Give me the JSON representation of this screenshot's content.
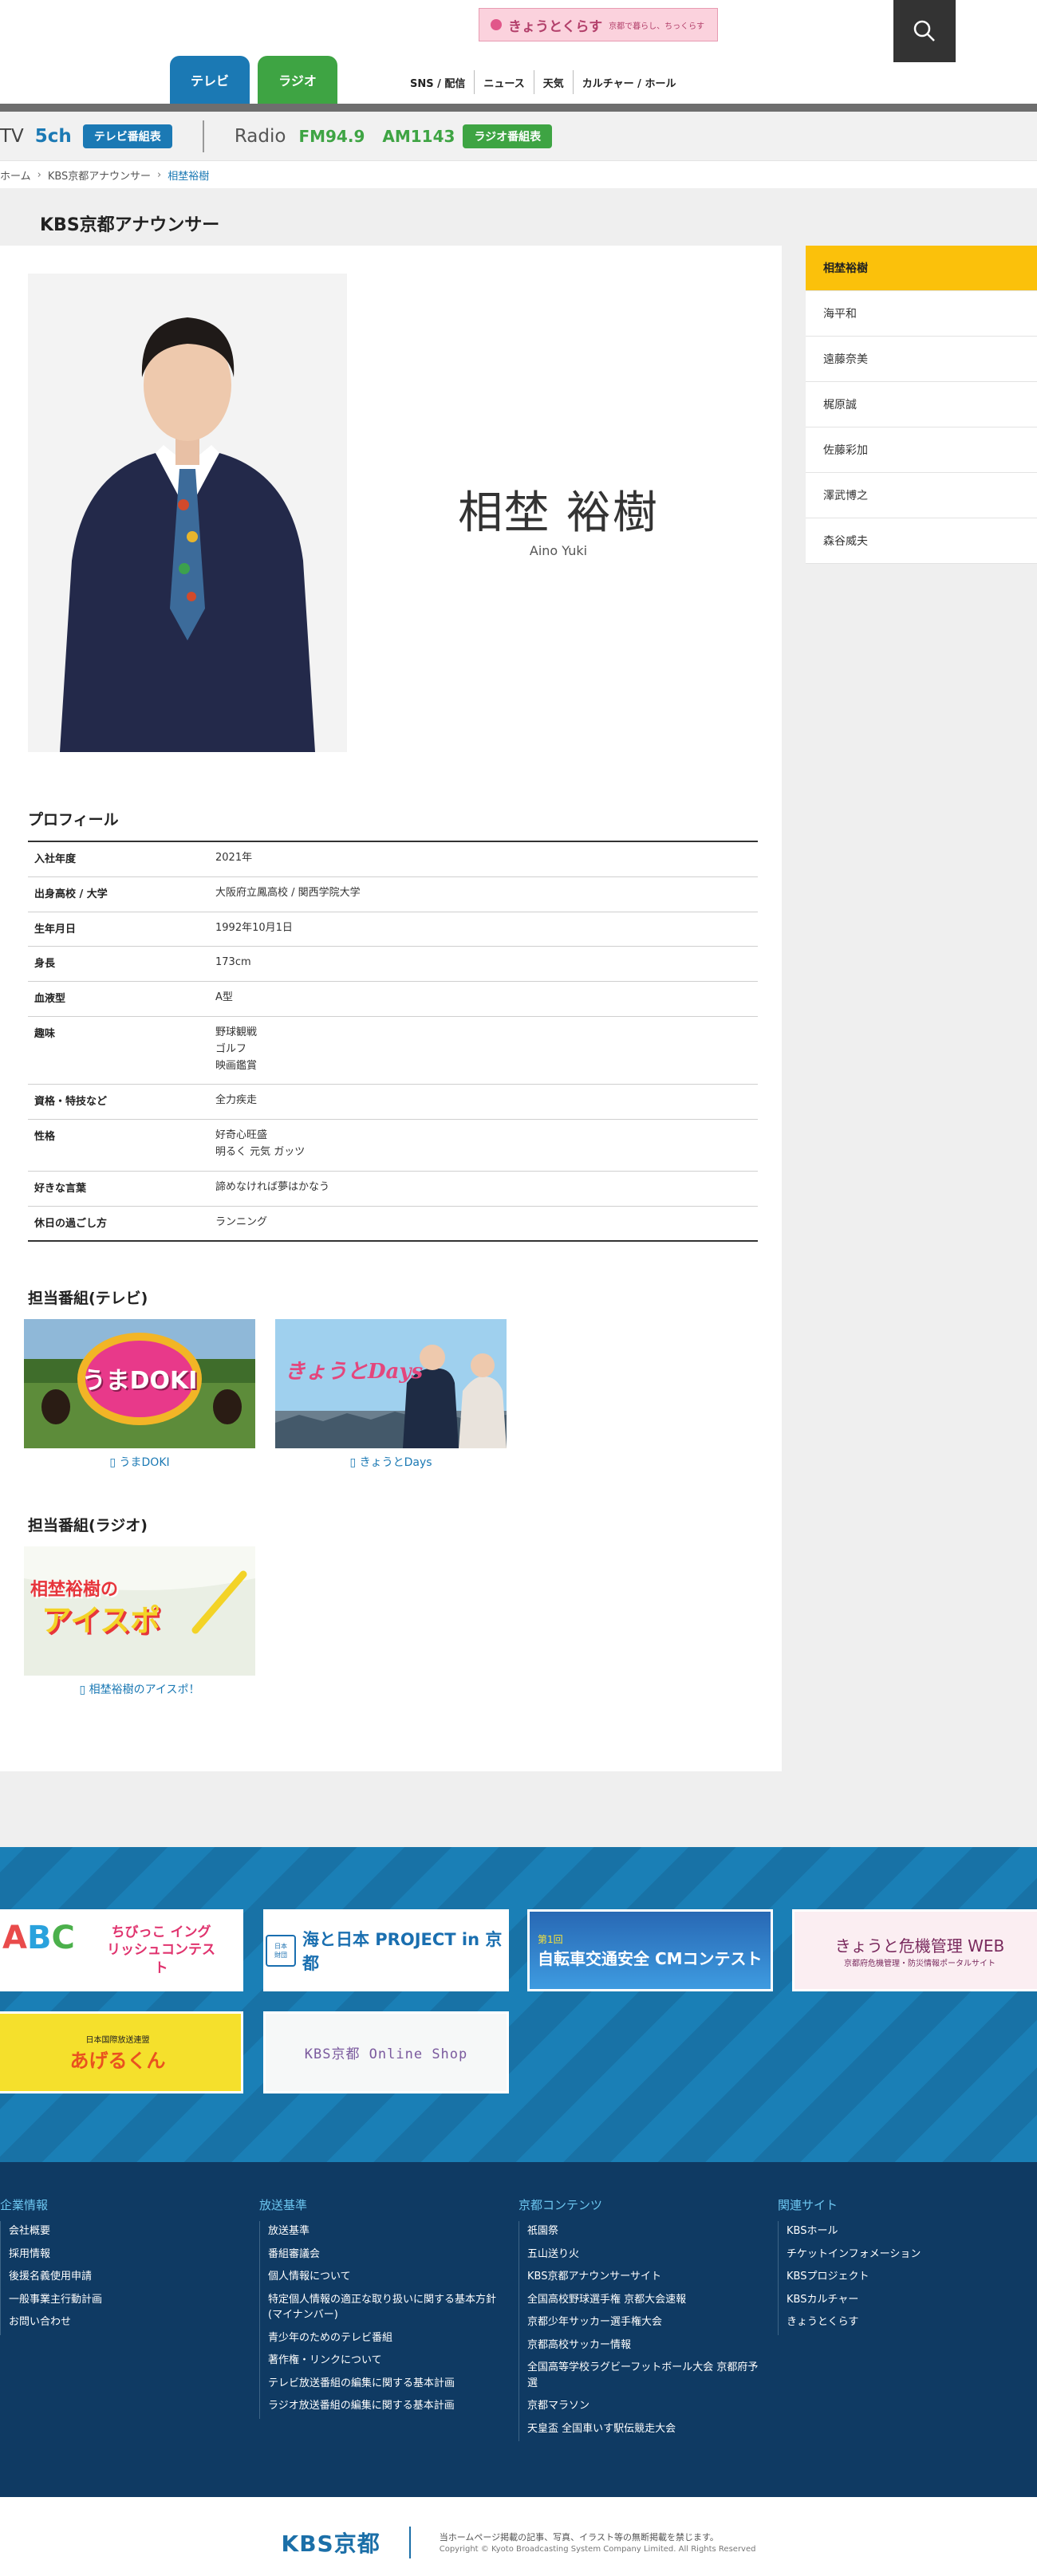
{
  "header": {
    "kyoto_banner_title": "きょうとくらす",
    "kyoto_banner_sub": "京都で暮らし、ちっくらす",
    "tabs": [
      {
        "label": "テレビ"
      },
      {
        "label": "ラジオ"
      }
    ],
    "gnav": [
      "SNS / 配信",
      "ニュース",
      "天気",
      "カルチャー / ホール"
    ]
  },
  "schedule": {
    "tv_label": "TV",
    "tv_channel": "5ch",
    "tv_button": "テレビ番組表",
    "radio_label": "Radio",
    "fm": "FM94.9",
    "am": "AM1143",
    "radio_button": "ラジオ番組表"
  },
  "breadcrumb": [
    "ホーム",
    "KBS京都アナウンサー",
    "相埜裕樹"
  ],
  "page_title": "KBS京都アナウンサー",
  "announcer": {
    "name_jp": "相埜 裕樹",
    "name_en": "Aino Yuki"
  },
  "profile": {
    "heading": "プロフィール",
    "rows": [
      {
        "k": "入社年度",
        "v": "2021年"
      },
      {
        "k": "出身高校 / 大学",
        "v": "大阪府立鳳高校 / 関西学院大学"
      },
      {
        "k": "生年月日",
        "v": "1992年10月1日"
      },
      {
        "k": "身長",
        "v": "173cm"
      },
      {
        "k": "血液型",
        "v": "A型"
      },
      {
        "k": "趣味",
        "v": "野球観戦\nゴルフ\n映画鑑賞"
      },
      {
        "k": "資格・特技など",
        "v": "全力疾走"
      },
      {
        "k": "性格",
        "v": "好奇心旺盛\n明るく 元気 ガッツ"
      },
      {
        "k": "好きな言葉",
        "v": "諦めなければ夢はかなう"
      },
      {
        "k": "休日の過ごし方",
        "v": "ランニング"
      }
    ]
  },
  "tv_programs": {
    "heading": "担当番組(テレビ)",
    "items": [
      {
        "caption": "うまDOKI",
        "logo": "うまDOKI"
      },
      {
        "caption": "きょうとDays",
        "logo": "きょうとDays"
      }
    ]
  },
  "radio_programs": {
    "heading": "担当番組(ラジオ)",
    "items": [
      {
        "caption": "相埜裕樹のアイスポ！",
        "logo_top": "相埜裕樹の",
        "logo_main": "アイスポ"
      }
    ]
  },
  "sidebar": [
    "相埜裕樹",
    "海平和",
    "遠藤奈美",
    "梶原誠",
    "佐藤彩加",
    "澤武博之",
    "森谷威夫"
  ],
  "banners": [
    {
      "text": "ちびっこ イングリッシュコンテスト"
    },
    {
      "text": "海と日本 PROJECT in 京都",
      "sub": "THE NIPPON FOUNDATION"
    },
    {
      "text": "自転車交通安全 CMコンテスト",
      "sub": "第1回"
    },
    {
      "text": "きょうと危機管理 WEB",
      "sub": "京都府危機管理・防災情報ポータルサイト"
    },
    {
      "text": "あげるくん",
      "sub": "日本国際放送連盟"
    },
    {
      "text": "KBS京都 Online Shop"
    }
  ],
  "footer": {
    "cols": [
      {
        "title": "企業情報",
        "items": [
          "会社概要",
          "採用情報",
          "後援名義使用申請",
          "一般事業主行動計画",
          "お問い合わせ"
        ]
      },
      {
        "title": "放送基準",
        "items": [
          "放送基準",
          "番組審議会",
          "個人情報について",
          "特定個人情報の適正な取り扱いに関する基本方針(マイナンバー)",
          "青少年のためのテレビ番組",
          "著作権・リンクについて",
          "テレビ放送番組の編集に関する基本計画",
          "ラジオ放送番組の編集に関する基本計画"
        ]
      },
      {
        "title": "京都コンテンツ",
        "items": [
          "祇園祭",
          "五山送り火",
          "KBS京都アナウンサーサイト",
          "全国高校野球選手権 京都大会速報",
          "京都少年サッカー選手権大会",
          "京都高校サッカー情報",
          "全国高等学校ラグビーフットボール大会 京都府予選",
          "京都マラソン",
          "天皇盃 全国車いす駅伝競走大会"
        ]
      },
      {
        "title": "関連サイト",
        "items": [
          "KBSホール",
          "チケットインフォメーション",
          "KBSプロジェクト",
          "KBSカルチャー",
          "きょうとくらす"
        ]
      }
    ]
  },
  "bottom": {
    "logo": "KBS京都",
    "notice": "当ホームページ掲載の記事、写真、イラスト等の無断掲載を禁じます。",
    "copyright": "Copyright © Kyoto Broadcasting System Company Limited. All Rights Reserved"
  },
  "colors": {
    "tv_blue": "#1b79b4",
    "radio_green": "#3ea443",
    "sidebar_active": "#fbc10b",
    "footer_bg": "#0f3a63"
  }
}
